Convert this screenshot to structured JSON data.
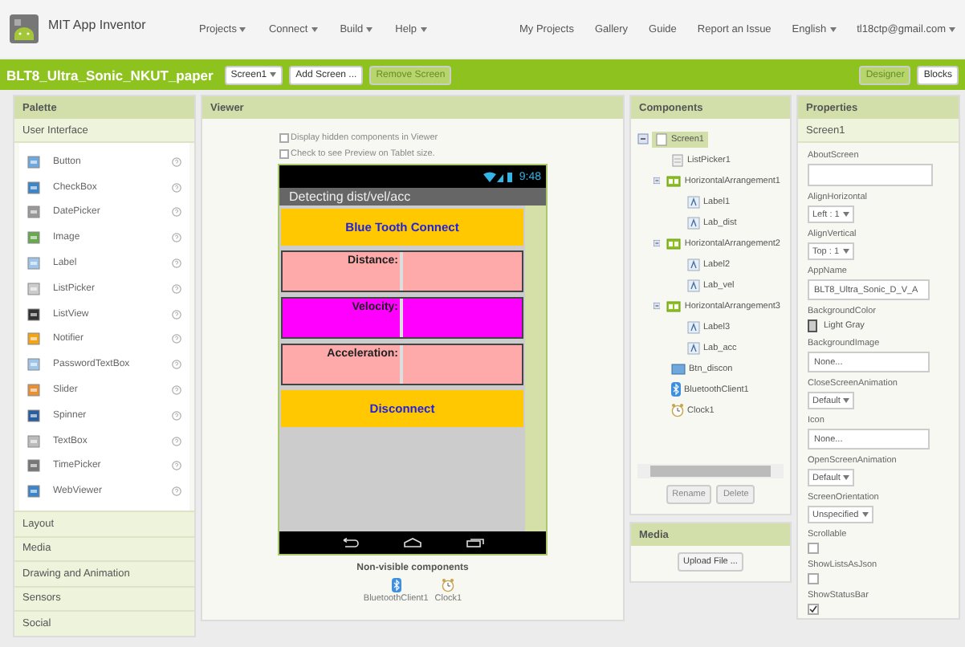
{
  "header": {
    "app_name": "MIT App Inventor",
    "menus": [
      {
        "label": "Projects",
        "dropdown": true
      },
      {
        "label": "Connect",
        "dropdown": true
      },
      {
        "label": "Build",
        "dropdown": true
      },
      {
        "label": "Help",
        "dropdown": true
      }
    ],
    "links": [
      {
        "label": "My Projects",
        "dropdown": false
      },
      {
        "label": "Gallery",
        "dropdown": false
      },
      {
        "label": "Guide",
        "dropdown": false
      },
      {
        "label": "Report an Issue",
        "dropdown": false
      },
      {
        "label": "English",
        "dropdown": true
      },
      {
        "label": "tl18ctp@gmail.com",
        "dropdown": true
      }
    ]
  },
  "project_bar": {
    "title": "BLT8_Ultra_Sonic_NKUT_paper",
    "screen": "Screen1",
    "buttons": [
      {
        "label": "Add Screen ...",
        "disabled": false
      },
      {
        "label": "Remove Screen",
        "disabled": true
      }
    ],
    "modes": [
      {
        "label": "Designer",
        "selected": true
      },
      {
        "label": "Blocks",
        "selected": false
      }
    ]
  },
  "palette": {
    "title": "Palette",
    "section": "User Interface",
    "items": [
      "Button",
      "CheckBox",
      "DatePicker",
      "Image",
      "Label",
      "ListPicker",
      "ListView",
      "Notifier",
      "PasswordTextBox",
      "Slider",
      "Spinner",
      "TextBox",
      "TimePicker",
      "WebViewer"
    ],
    "categories": [
      "Layout",
      "Media",
      "Drawing and Animation",
      "Sensors",
      "Social"
    ]
  },
  "viewer": {
    "title": "Viewer",
    "options": [
      {
        "label": "Display hidden components in Viewer",
        "checked": false
      },
      {
        "label": "Check to see Preview on Tablet size.",
        "checked": false
      }
    ],
    "phone": {
      "time": "9:48",
      "title": "Detecting dist/vel/acc",
      "components": [
        {
          "kind": "button",
          "text": "Blue Tooth Connect",
          "color": "#ffc800"
        },
        {
          "kind": "row",
          "text": "Distance:",
          "color": "#ffaaaa"
        },
        {
          "kind": "row",
          "text": "Velocity:",
          "color": "#ff00ff"
        },
        {
          "kind": "row",
          "text": "Acceleration:",
          "color": "#ffaaaa"
        },
        {
          "kind": "button",
          "text": "Disconnect",
          "color": "#ffc800"
        }
      ]
    },
    "nonvisible_title": "Non-visible components",
    "nonvisible": [
      {
        "kind": "bluetooth",
        "label": "BluetoothClient1"
      },
      {
        "kind": "clock",
        "label": "Clock1"
      }
    ]
  },
  "components": {
    "title": "Components",
    "tree": [
      {
        "label": "Screen1",
        "kind": "screen",
        "selected": true,
        "expanded": true,
        "children": [
          {
            "label": "ListPicker1",
            "kind": "listpicker",
            "selected": false
          },
          {
            "label": "HorizontalArrangement1",
            "kind": "arrangement",
            "selected": false,
            "expanded": true,
            "children": [
              {
                "label": "Label1",
                "kind": "label",
                "selected": false
              },
              {
                "label": "Lab_dist",
                "kind": "label",
                "selected": false
              }
            ]
          },
          {
            "label": "HorizontalArrangement2",
            "kind": "arrangement",
            "selected": false,
            "expanded": true,
            "children": [
              {
                "label": "Label2",
                "kind": "label",
                "selected": false
              },
              {
                "label": "Lab_vel",
                "kind": "label",
                "selected": false
              }
            ]
          },
          {
            "label": "HorizontalArrangement3",
            "kind": "arrangement",
            "selected": false,
            "expanded": true,
            "children": [
              {
                "label": "Label3",
                "kind": "label",
                "selected": false
              },
              {
                "label": "Lab_acc",
                "kind": "label",
                "selected": false
              }
            ]
          },
          {
            "label": "Btn_discon",
            "kind": "button",
            "selected": false
          },
          {
            "label": "BluetoothClient1",
            "kind": "bluetooth",
            "selected": false
          },
          {
            "label": "Clock1",
            "kind": "clock",
            "selected": false
          }
        ]
      }
    ],
    "buttons": [
      "Rename",
      "Delete"
    ]
  },
  "media": {
    "title": "Media",
    "button": "Upload File ..."
  },
  "properties": {
    "title": "Properties",
    "component": "Screen1",
    "items": [
      {
        "kind": "textarea",
        "label": "AboutScreen"
      },
      {
        "kind": "select",
        "label": "AlignHorizontal",
        "value": "Left : 1"
      },
      {
        "kind": "select",
        "label": "AlignVertical",
        "value": "Top : 1"
      },
      {
        "kind": "text",
        "label": "AppName",
        "value": "BLT8_Ultra_Sonic_D_V_A"
      },
      {
        "kind": "color",
        "label": "BackgroundColor",
        "value": "Light Gray",
        "color": "#cccccc"
      },
      {
        "kind": "text",
        "label": "BackgroundImage",
        "value": "None..."
      },
      {
        "kind": "select",
        "label": "CloseScreenAnimation",
        "value": "Default"
      },
      {
        "kind": "text",
        "label": "Icon",
        "value": "None..."
      },
      {
        "kind": "select",
        "label": "OpenScreenAnimation",
        "value": "Default"
      },
      {
        "kind": "select",
        "label": "ScreenOrientation",
        "value": "Unspecified"
      },
      {
        "kind": "checkbox",
        "label": "Scrollable",
        "checked": false
      },
      {
        "kind": "checkbox",
        "label": "ShowListsAsJson",
        "checked": false
      },
      {
        "kind": "checkbox",
        "label": "ShowStatusBar",
        "checked": true
      }
    ]
  }
}
